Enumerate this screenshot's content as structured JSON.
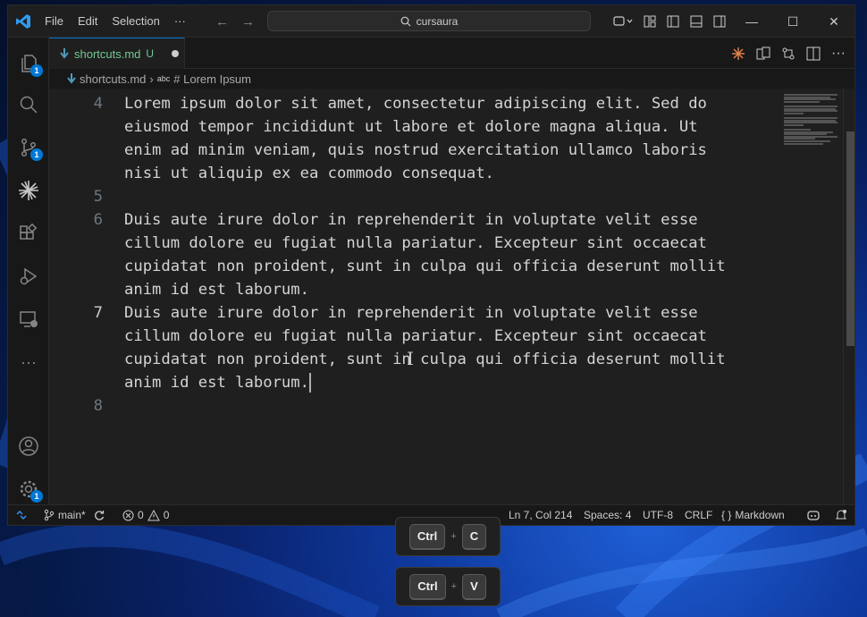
{
  "titlebar": {
    "menu": [
      "File",
      "Edit",
      "Selection",
      "···"
    ],
    "search_text": "cursaura"
  },
  "activitybar": {
    "badges": {
      "explorer": "1",
      "source_control": "1",
      "settings": "1"
    }
  },
  "tab": {
    "filename": "shortcuts.md",
    "status": "U"
  },
  "breadcrumb": {
    "file": "shortcuts.md",
    "symbol": "# Lorem Ipsum"
  },
  "editor": {
    "lines": [
      {
        "number": "4",
        "rows": [
          "Lorem ipsum dolor sit amet, consectetur adipiscing elit. Sed do",
          "eiusmod tempor incididunt ut labore et dolore magna aliqua. Ut",
          "enim ad minim veniam, quis nostrud exercitation ullamco laboris",
          "nisi ut aliquip ex ea commodo consequat."
        ]
      },
      {
        "number": "5",
        "rows": [
          ""
        ]
      },
      {
        "number": "6",
        "rows": [
          "Duis aute irure dolor in reprehenderit in voluptate velit esse",
          "cillum dolore eu fugiat nulla pariatur. Excepteur sint occaecat",
          "cupidatat non proident, sunt in culpa qui officia deserunt mollit",
          "anim id est laborum."
        ]
      },
      {
        "number": "7",
        "rows": [
          "Duis aute irure dolor in reprehenderit in voluptate velit esse",
          "cillum dolore eu fugiat nulla pariatur. Excepteur sint occaecat",
          "cupidatat non proident, sunt in culpa qui officia deserunt mollit",
          "anim id est laborum."
        ]
      },
      {
        "number": "8",
        "rows": [
          ""
        ]
      }
    ],
    "current_line": "7"
  },
  "statusbar": {
    "branch": "main*",
    "errors": "0",
    "warnings": "0",
    "position": "Ln 7, Col 214",
    "spaces": "Spaces: 4",
    "encoding": "UTF-8",
    "eol": "CRLF",
    "language": "Markdown"
  },
  "keyhints": [
    {
      "modifier": "Ctrl",
      "plus": "+",
      "key": "C"
    },
    {
      "modifier": "Ctrl",
      "plus": "+",
      "key": "V"
    }
  ],
  "colors": {
    "accent": "#0078d4",
    "untracked": "#73c991",
    "editor_bg": "#1f1f1f"
  }
}
